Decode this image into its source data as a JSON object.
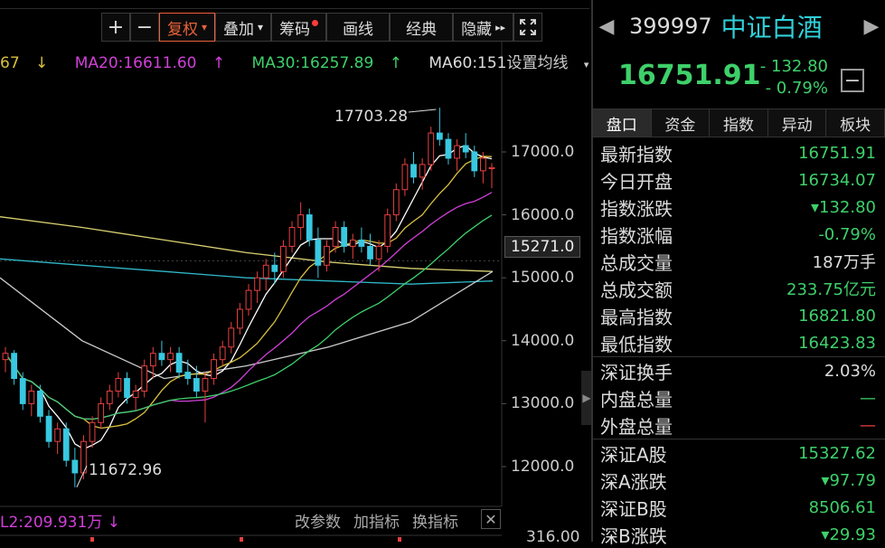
{
  "toolbar": {
    "plus": "+",
    "minus": "−",
    "fuquan": "复权",
    "diejia": "叠加",
    "chouma": "筹码",
    "huaxian": "画线",
    "jingdian": "经典",
    "yincang": "隐藏",
    "caret": "▾",
    "double_arrow": "▸▸"
  },
  "ma_legend": {
    "ma_prefix": "67",
    "ma_prefix_arrow": "↓",
    "ma20": "MA20:16611.60",
    "ma20_arrow": "↑",
    "ma30": "MA30:16257.89",
    "ma30_arrow": "↑",
    "ma60": "MA60:151",
    "setting": "设置均线",
    "setting_caret": "▾",
    "colors": {
      "ma_prefix": "#d8c040",
      "ma20": "#d040d8",
      "ma30": "#3ed06a",
      "ma60": "#ddd"
    }
  },
  "chart_labels": {
    "high_annot": "17703.28",
    "low_annot": "11672.96",
    "y_ticks": [
      "17000.0",
      "16000.0",
      "15000.0",
      "14000.0",
      "13000.0",
      "12000.0"
    ],
    "current": "15271.0",
    "vol_tick": "316.00"
  },
  "bottom": {
    "indicator": "L2:209.931万",
    "indicator_arrow": "↓",
    "links": [
      "改参数",
      "加指标",
      "换指标"
    ],
    "close": "✕"
  },
  "quote": {
    "code": "399997",
    "name": "中证白酒",
    "price": "16751.91",
    "change": "- 132.80",
    "change_pct": "- 0.79%",
    "tabs": [
      "盘口",
      "资金",
      "指数",
      "异动",
      "板块"
    ],
    "rows": [
      {
        "k": "最新指数",
        "v": "16751.91",
        "c": "green"
      },
      {
        "k": "今日开盘",
        "v": "16734.07",
        "c": "green"
      },
      {
        "k": "指数涨跌",
        "v": "▾132.80",
        "c": "green"
      },
      {
        "k": "指数涨幅",
        "v": "-0.79%",
        "c": "green"
      },
      {
        "k": "总成交量",
        "v": "187万手",
        "c": "white"
      },
      {
        "k": "总成交额",
        "v": "233.75亿元",
        "c": "green"
      },
      {
        "k": "最高指数",
        "v": "16821.80",
        "c": "green"
      },
      {
        "k": "最低指数",
        "v": "16423.83",
        "c": "green"
      },
      {
        "k": "深证换手",
        "v": "2.03%",
        "c": "white"
      },
      {
        "k": "内盘总量",
        "v": "—",
        "c": "green"
      },
      {
        "k": "外盘总量",
        "v": "—",
        "c": "red"
      },
      {
        "k": "深证A股",
        "v": "15327.62",
        "c": "green"
      },
      {
        "k": "深A涨跌",
        "v": "▾97.79",
        "c": "green"
      },
      {
        "k": "深证B股",
        "v": "8506.61",
        "c": "green"
      },
      {
        "k": "深B涨跌",
        "v": "▾29.93",
        "c": "green"
      }
    ]
  },
  "chart_data": {
    "type": "candlestick",
    "y_axis": {
      "min": 11500,
      "max": 17800,
      "ticks": [
        12000,
        13000,
        14000,
        15000,
        16000,
        17000
      ]
    },
    "current_price_line": 15271.0,
    "high_annotation": 17703.28,
    "low_annotation": 11672.96,
    "candles": [
      [
        13700,
        13900,
        13500,
        13800
      ],
      [
        13800,
        13850,
        13300,
        13400
      ],
      [
        13400,
        13500,
        12900,
        13000
      ],
      [
        13000,
        13300,
        12800,
        13200
      ],
      [
        13200,
        13300,
        12700,
        12800
      ],
      [
        12800,
        12900,
        12300,
        12400
      ],
      [
        12400,
        12700,
        12200,
        12600
      ],
      [
        12600,
        12700,
        12000,
        12100
      ],
      [
        12100,
        12300,
        11672.96,
        11900
      ],
      [
        11900,
        12500,
        11800,
        12400
      ],
      [
        12400,
        12800,
        12300,
        12700
      ],
      [
        12700,
        13100,
        12600,
        13000
      ],
      [
        13000,
        13300,
        12900,
        13200
      ],
      [
        13200,
        13500,
        13100,
        13400
      ],
      [
        13400,
        13500,
        13000,
        13100
      ],
      [
        13100,
        13300,
        12900,
        13200
      ],
      [
        13200,
        13700,
        13100,
        13600
      ],
      [
        13600,
        13900,
        13400,
        13800
      ],
      [
        13800,
        14000,
        13600,
        13700
      ],
      [
        13700,
        13900,
        13500,
        13800
      ],
      [
        13800,
        13900,
        13400,
        13500
      ],
      [
        13500,
        13700,
        13300,
        13400
      ],
      [
        13400,
        13600,
        13100,
        13200
      ],
      [
        13200,
        13500,
        12700,
        13400
      ],
      [
        13400,
        13800,
        13300,
        13700
      ],
      [
        13700,
        14000,
        13600,
        13900
      ],
      [
        13900,
        14300,
        13800,
        14200
      ],
      [
        14200,
        14600,
        14100,
        14500
      ],
      [
        14500,
        14900,
        14400,
        14800
      ],
      [
        14800,
        15100,
        14600,
        15000
      ],
      [
        15000,
        15300,
        14800,
        15200
      ],
      [
        15200,
        15400,
        14900,
        15100
      ],
      [
        15100,
        15600,
        15000,
        15500
      ],
      [
        15500,
        15900,
        15400,
        15800
      ],
      [
        15800,
        16200,
        15600,
        16000
      ],
      [
        16000,
        16100,
        15500,
        15600
      ],
      [
        15600,
        15800,
        15000,
        15200
      ],
      [
        15200,
        15600,
        15100,
        15500
      ],
      [
        15500,
        15900,
        15400,
        15800
      ],
      [
        15800,
        15900,
        15400,
        15500
      ],
      [
        15500,
        15700,
        15300,
        15600
      ],
      [
        15600,
        15800,
        15400,
        15500
      ],
      [
        15500,
        15700,
        15200,
        15300
      ],
      [
        15300,
        15600,
        15100,
        15500
      ],
      [
        15500,
        16100,
        15400,
        16000
      ],
      [
        16000,
        16500,
        15900,
        16400
      ],
      [
        16400,
        16900,
        16300,
        16800
      ],
      [
        16800,
        17000,
        16500,
        16600
      ],
      [
        16600,
        16900,
        16400,
        16800
      ],
      [
        16800,
        17400,
        16700,
        17300
      ],
      [
        17300,
        17703.28,
        17100,
        17200
      ],
      [
        17200,
        17300,
        16800,
        16900
      ],
      [
        16900,
        17200,
        16700,
        17100
      ],
      [
        17100,
        17300,
        16900,
        17000
      ],
      [
        17000,
        17100,
        16600,
        16700
      ],
      [
        16700,
        17000,
        16500,
        16900
      ],
      [
        16734.07,
        16821.8,
        16423.83,
        16751.91
      ]
    ]
  }
}
